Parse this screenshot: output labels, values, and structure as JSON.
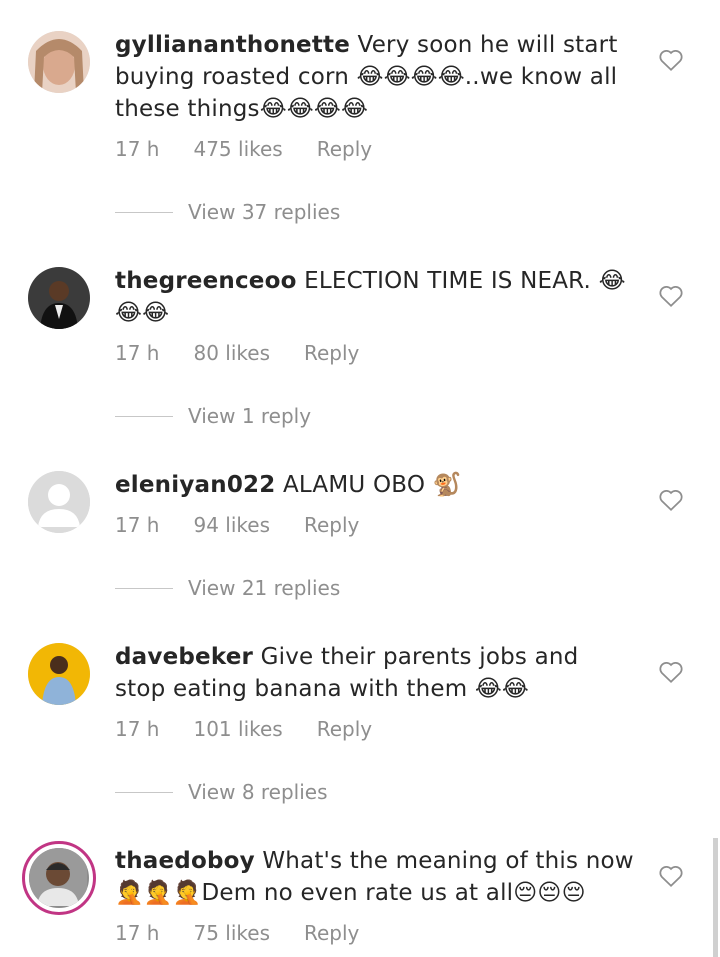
{
  "comments": [
    {
      "username": "gylliananthonette",
      "text": "Very soon he will start buying roasted corn 😂😂😂😂..we know all these things😂😂😂😂",
      "time": "17 h",
      "likes": "475 likes",
      "reply": "Reply",
      "view_replies": "View 37 replies"
    },
    {
      "username": "thegreenceoo",
      "text": "ELECTION TIME IS NEAR. 😂😂😂",
      "time": "17 h",
      "likes": "80 likes",
      "reply": "Reply",
      "view_replies": "View 1 reply"
    },
    {
      "username": "eleniyan022",
      "text": "ALAMU OBO 🐒",
      "time": "17 h",
      "likes": "94 likes",
      "reply": "Reply",
      "view_replies": "View 21 replies"
    },
    {
      "username": "davebeker",
      "text": "Give their parents jobs and stop eating banana with them 😂😂",
      "time": "17 h",
      "likes": "101 likes",
      "reply": "Reply",
      "view_replies": "View 8 replies"
    },
    {
      "username": "thaedoboy",
      "text": "What's the meaning of this now 🤦🤦🤦Dem no even rate us at all😔😔😔",
      "time": "17 h",
      "likes": "75 likes",
      "reply": "Reply"
    }
  ],
  "icons": {
    "like": "heart-outline-icon"
  },
  "colors": {
    "muted": "#8e8e8e",
    "story_ring": "#c13584"
  }
}
